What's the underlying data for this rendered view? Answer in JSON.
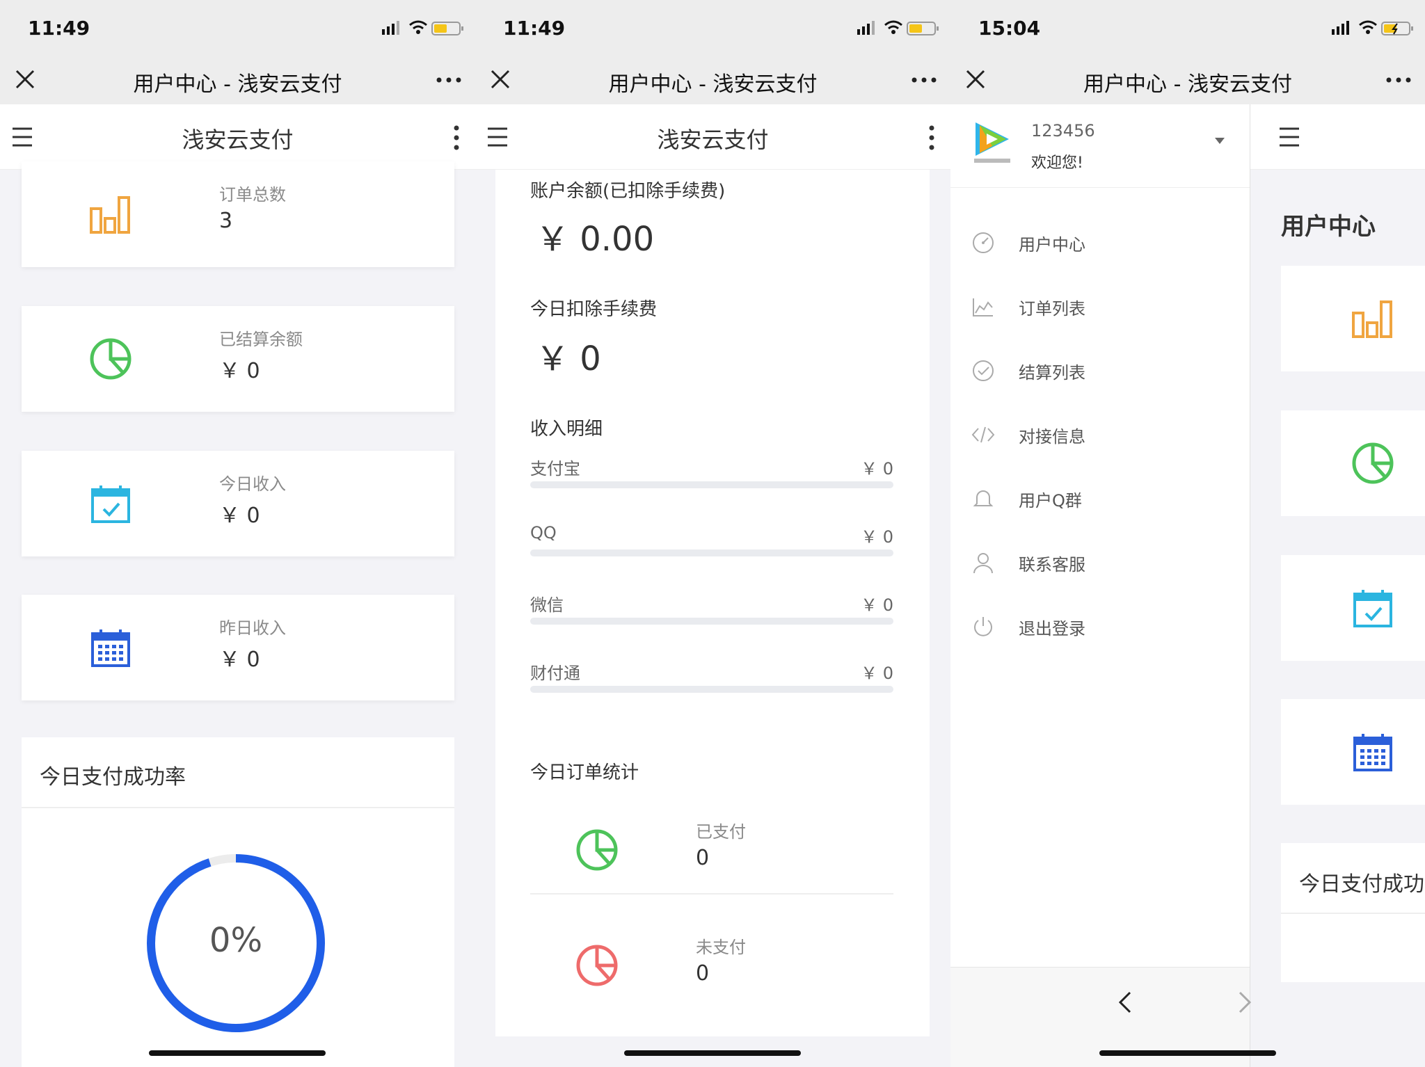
{
  "wechat": {
    "title": "用户中心 - 浅安云支付"
  },
  "app": {
    "title": "浅安云支付"
  },
  "colors": {
    "accent_blue": "#1f5ee8",
    "orange": "#f0a540",
    "green": "#4dc35a",
    "cyan": "#2bb5e0",
    "blue": "#2b5fd9",
    "red": "#ee6b6b"
  },
  "screen1": {
    "time": "11:49",
    "cards": [
      {
        "icon": "bar-chart-icon",
        "label": "订单总数",
        "value": "3"
      },
      {
        "icon": "pie-chart-icon",
        "label": "已结算余额",
        "value": "￥ 0"
      },
      {
        "icon": "calendar-check-icon",
        "label": "今日收入",
        "value": "￥ 0"
      },
      {
        "icon": "calendar-grid-icon",
        "label": "昨日收入",
        "value": "￥ 0"
      }
    ],
    "rate": {
      "title": "今日支付成功率",
      "percent_text": "0%",
      "progress_fraction": 0.95
    }
  },
  "screen2": {
    "time": "11:49",
    "balance_label": "账户余额(已扣除手续费)",
    "balance_value": "￥ 0.00",
    "fee_label": "今日扣除手续费",
    "fee_value": "￥ 0",
    "income_title": "收入明细",
    "income": [
      {
        "name": "支付宝",
        "value": "￥ 0",
        "fraction": 0
      },
      {
        "name": "QQ",
        "value": "￥ 0",
        "fraction": 0
      },
      {
        "name": "微信",
        "value": "￥ 0",
        "fraction": 0
      },
      {
        "name": "财付通",
        "value": "￥ 0",
        "fraction": 0
      }
    ],
    "orders_title": "今日订单统计",
    "orders": [
      {
        "icon": "pie-chart-icon",
        "label": "已支付",
        "value": "0"
      },
      {
        "icon": "pie-chart-icon",
        "label": "未支付",
        "value": "0"
      }
    ]
  },
  "screen3": {
    "time": "15:04",
    "drawer": {
      "username": "123456",
      "welcome": "欢迎您!",
      "logo_icon": "video-play-logo-icon",
      "items": [
        {
          "icon": "dashboard-icon",
          "label": "用户中心"
        },
        {
          "icon": "chart-area-icon",
          "label": "订单列表"
        },
        {
          "icon": "check-circle-icon",
          "label": "结算列表"
        },
        {
          "icon": "code-icon",
          "label": "对接信息"
        },
        {
          "icon": "bell-icon",
          "label": "用户Q群"
        },
        {
          "icon": "user-icon",
          "label": "联系客服"
        },
        {
          "icon": "power-icon",
          "label": "退出登录"
        }
      ]
    },
    "behind": {
      "page_title": "用户中心",
      "rate_title": "今日支付成功"
    }
  }
}
